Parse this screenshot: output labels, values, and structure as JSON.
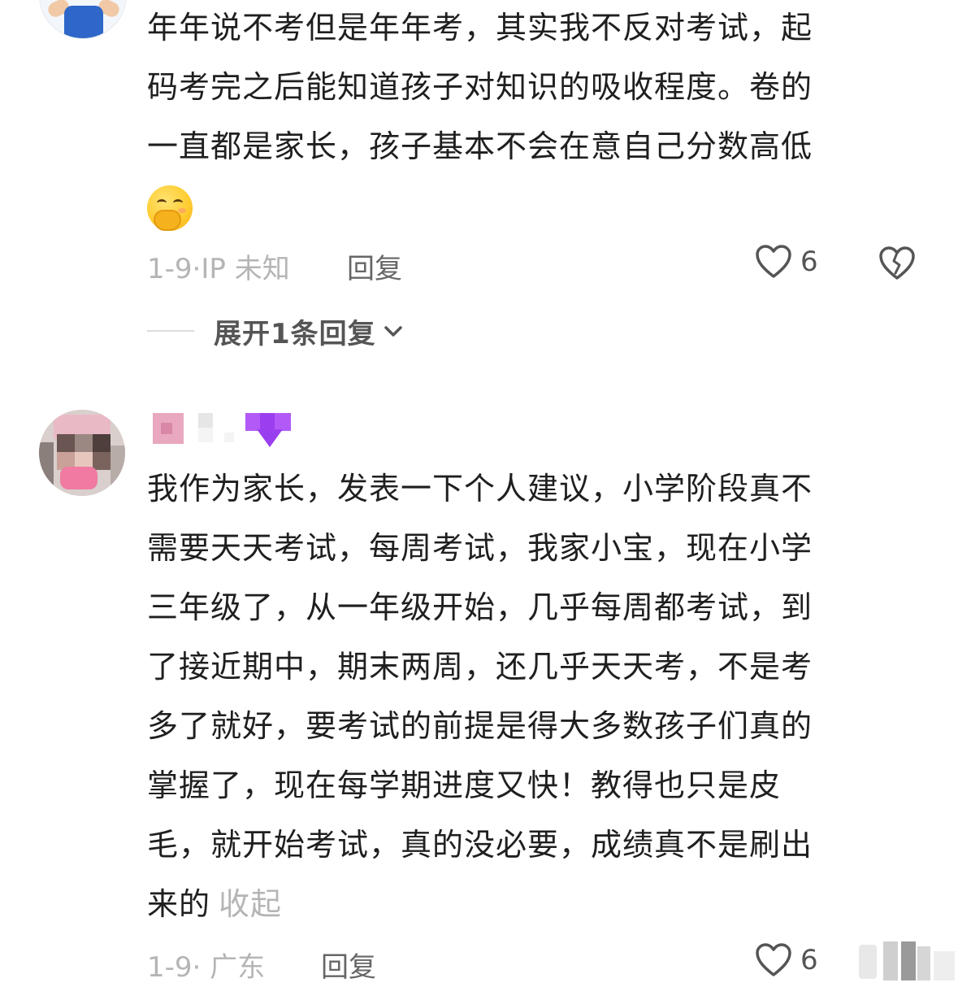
{
  "comments": [
    {
      "lines": [
        "年年说不考但是年年考，其实我不反对考试，起",
        "码考完之后能知道孩子对知识的吸收程度。卷的",
        "一直都是家长，孩子基本不会在意自己分数高低"
      ],
      "emoji": "shy-hand-over-mouth-emoji",
      "date": "1-9",
      "location": "IP 未知",
      "reply_label": "回复",
      "likes": "6",
      "expand_replies_label": "展开1条回复"
    },
    {
      "lines": [
        "我作为家长，发表一下个人建议，小学阶段真不",
        "需要天天考试，每周考试，我家小宝，现在小学",
        "三年级了，从一年级开始，几乎每周都考试，到",
        "了接近期中，期末两周，还几乎天天考，不是考",
        "多了就好，要考试的前提是得大多数孩子们真的",
        "掌握了，现在每学期进度又快！教得也只是皮",
        "毛，就开始考试，真的没必要，成绩真不是刷出"
      ],
      "last_line": "来的",
      "collapse_label": "收起",
      "date": "1-9",
      "location": "广东",
      "reply_label": "回复",
      "likes": "6"
    }
  ],
  "colors": {
    "text": "#1f1f1f",
    "meta": "#b5b5b5",
    "action": "#666666",
    "heart_stroke": "#555555",
    "badge_purple": "#a64bf4"
  }
}
